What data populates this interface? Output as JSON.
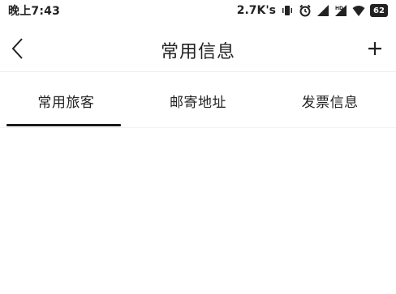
{
  "status_bar": {
    "time": "晚上7:43",
    "network_speed": "2.7K's",
    "battery_level": "62"
  },
  "header": {
    "title": "常用信息"
  },
  "tabs": [
    {
      "label": "常用旅客",
      "selected": true
    },
    {
      "label": "邮寄地址",
      "selected": false
    },
    {
      "label": "发票信息",
      "selected": false
    }
  ],
  "icons": {
    "back": "chevron-left-icon",
    "add": "plus-icon"
  },
  "colors": {
    "text": "#222222",
    "indicator": "#1a1a1a",
    "background": "#ffffff"
  }
}
